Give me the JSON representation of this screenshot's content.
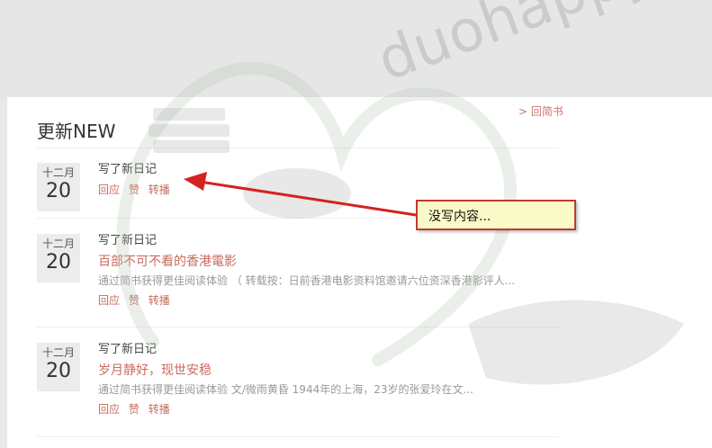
{
  "back_link": "> 回简书",
  "section_title": "更新NEW",
  "entries": [
    {
      "month": "十二月",
      "day": "20",
      "title": "写了新日记",
      "actions": [
        "回应",
        "赞",
        "转播"
      ]
    },
    {
      "month": "十二月",
      "day": "20",
      "title": "写了新日记",
      "headline": "百部不可不看的香港電影",
      "excerpt": "通过简书获得更佳阅读体验 （ 转载按：日前香港电影资料馆邀请六位资深香港影评人...",
      "actions": [
        "回应",
        "赞",
        "转播"
      ]
    },
    {
      "month": "十二月",
      "day": "20",
      "title": "写了新日记",
      "headline": "岁月静好，现世安稳",
      "excerpt": "通过简书获得更佳阅读体验 文/微雨黄昏 1944年的上海，23岁的张爱玲在文...",
      "actions": [
        "回应",
        "赞",
        "转播"
      ]
    }
  ],
  "callout_text": "没写内容...",
  "watermark_text": "duohappy",
  "colors": {
    "accent": "#cb6a5e",
    "arrow": "#d3231f",
    "callout_bg": "#fafac8"
  }
}
